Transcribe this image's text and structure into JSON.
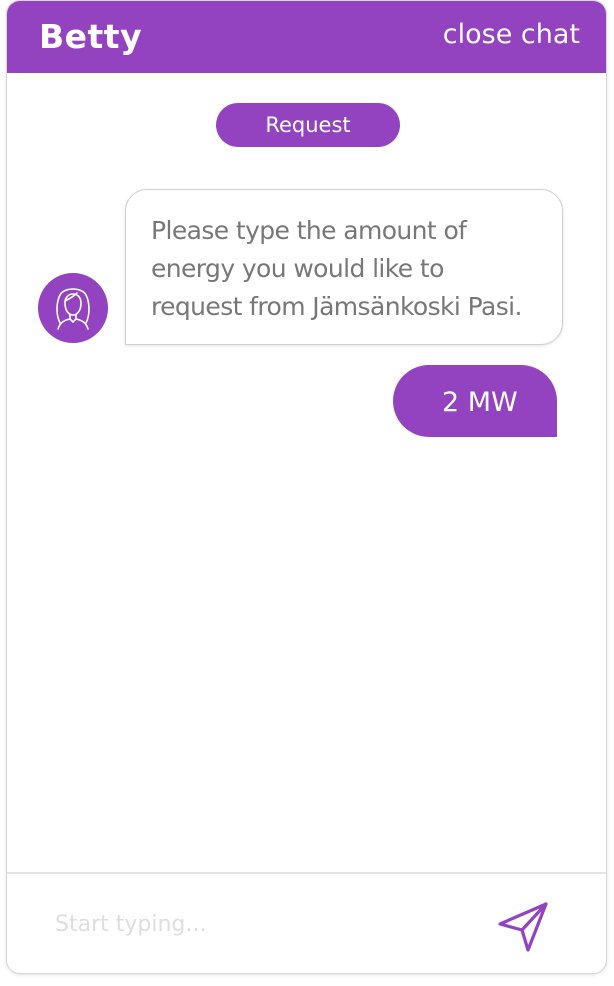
{
  "header": {
    "title": "Betty",
    "close_label": "close chat"
  },
  "conversation": {
    "tag_label": "Request",
    "messages": [
      {
        "sender": "bot",
        "text": "Please type the amount of\nenergy you would like to\nrequest from Jämsänkoski Pasi."
      },
      {
        "sender": "user",
        "text": "2 MW"
      }
    ]
  },
  "composer": {
    "placeholder": "Start typing...",
    "value": "",
    "send_icon": "send-icon"
  },
  "colors": {
    "accent": "#9342c0",
    "bot_text": "#777777",
    "placeholder": "#dedede"
  }
}
